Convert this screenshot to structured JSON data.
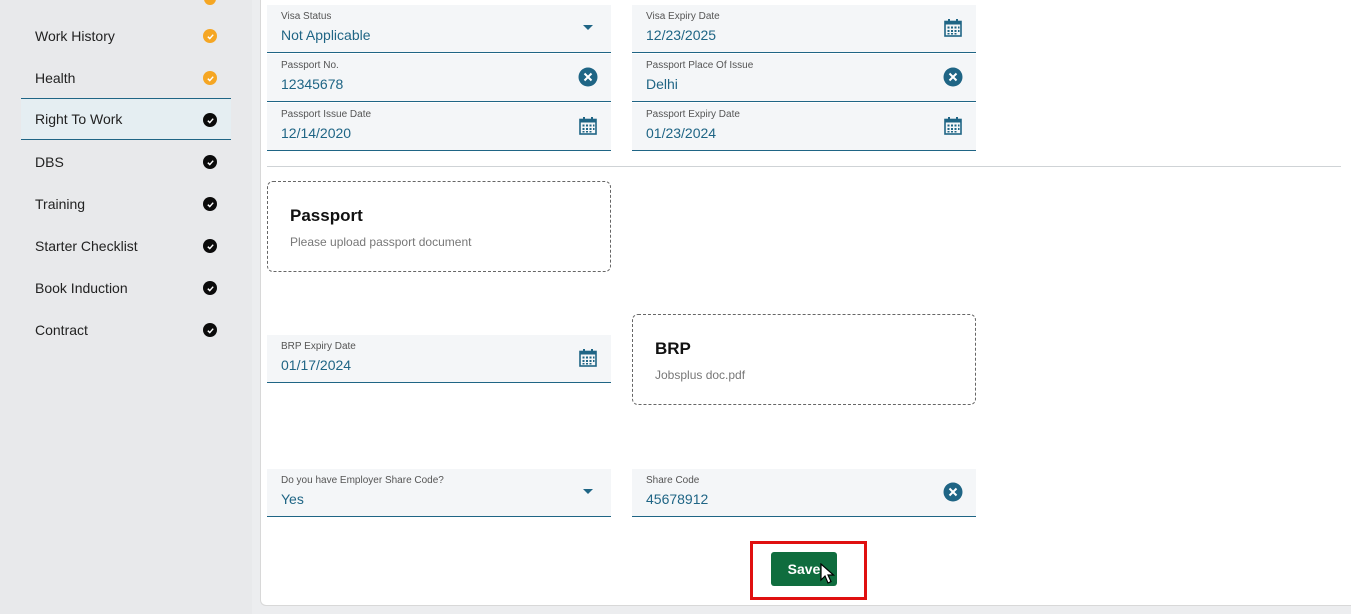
{
  "sidebar": {
    "items": [
      {
        "label": "Work History",
        "status": "warning"
      },
      {
        "label": "Health",
        "status": "warning"
      },
      {
        "label": "Right To Work",
        "status": "complete",
        "active": true
      },
      {
        "label": "DBS",
        "status": "complete"
      },
      {
        "label": "Training",
        "status": "complete"
      },
      {
        "label": "Starter Checklist",
        "status": "complete"
      },
      {
        "label": "Book Induction",
        "status": "complete"
      },
      {
        "label": "Contract",
        "status": "complete"
      }
    ]
  },
  "form": {
    "visa_status": {
      "label": "Visa Status",
      "value": "Not Applicable"
    },
    "visa_expiry": {
      "label": "Visa Expiry Date",
      "value": "12/23/2025"
    },
    "passport_no": {
      "label": "Passport No.",
      "value": "12345678"
    },
    "passport_place": {
      "label": "Passport Place Of Issue",
      "value": "Delhi"
    },
    "passport_issue": {
      "label": "Passport Issue Date",
      "value": "12/14/2020"
    },
    "passport_expiry": {
      "label": "Passport Expiry Date",
      "value": "01/23/2024"
    },
    "brp_expiry": {
      "label": "BRP Expiry Date",
      "value": "01/17/2024"
    },
    "share_code_question": {
      "label": "Do you have Employer Share Code?",
      "value": "Yes"
    },
    "share_code": {
      "label": "Share Code",
      "value": "45678912"
    }
  },
  "uploads": {
    "passport": {
      "title": "Passport",
      "subtitle": "Please upload passport document"
    },
    "brp": {
      "title": "BRP",
      "subtitle": "Jobsplus doc.pdf"
    }
  },
  "actions": {
    "save_label": "Save"
  },
  "colors": {
    "accent": "#1f6585",
    "save": "#0f6d3e",
    "warning": "#f5a623",
    "complete": "#0b0b0b",
    "highlight": "#e01010"
  },
  "icons": {
    "dropdown": "chevron-down-icon",
    "calendar": "calendar-icon",
    "clear": "clear-icon",
    "check": "check-icon"
  }
}
